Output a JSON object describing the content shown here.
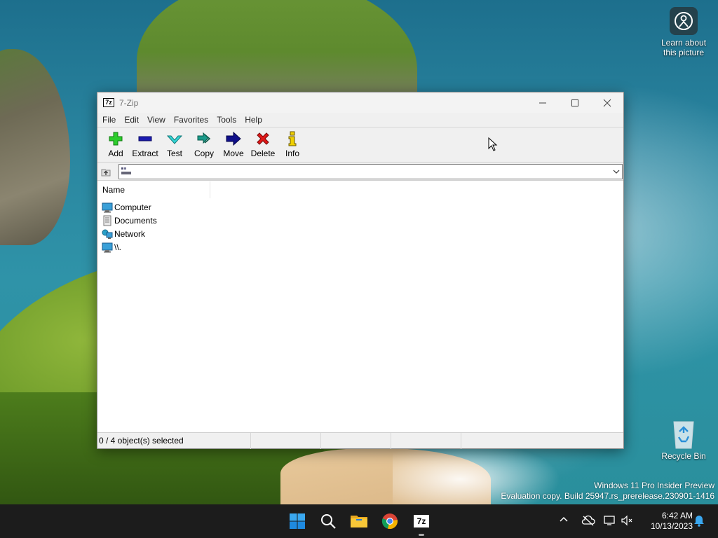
{
  "desktop": {
    "learn_icon_label": "Learn about this picture",
    "recycle_bin_label": "Recycle Bin",
    "watermark_line1": "Windows 11 Pro Insider Preview",
    "watermark_line2": "Evaluation copy. Build 25947.rs_prerelease.230901-1416"
  },
  "window": {
    "title": "7-Zip",
    "app_icon_text": "7z",
    "menu": [
      "File",
      "Edit",
      "View",
      "Favorites",
      "Tools",
      "Help"
    ],
    "toolbar": [
      {
        "label": "Add",
        "icon": "plus-icon",
        "color": "#22aa22"
      },
      {
        "label": "Extract",
        "icon": "minus-icon",
        "color": "#1a1aa0"
      },
      {
        "label": "Test",
        "icon": "check-icon",
        "color": "#1aa0a0"
      },
      {
        "label": "Copy",
        "icon": "double-arrow-icon",
        "color": "#1a7a6a"
      },
      {
        "label": "Move",
        "icon": "arrow-right-icon",
        "color": "#10107a"
      },
      {
        "label": "Delete",
        "icon": "x-icon",
        "color": "#d81a1a"
      },
      {
        "label": "Info",
        "icon": "info-icon",
        "color": "#e0c000"
      }
    ],
    "address": {
      "path_value": ""
    },
    "columns": {
      "name": "Name"
    },
    "items": [
      {
        "name": "Computer",
        "icon": "computer-icon"
      },
      {
        "name": "Documents",
        "icon": "document-icon"
      },
      {
        "name": "Network",
        "icon": "network-icon"
      },
      {
        "name": "\\\\.",
        "icon": "computer-icon"
      }
    ],
    "status": {
      "selection": "0 / 4 object(s) selected",
      "cell2": "",
      "cell3": "",
      "cell4": ""
    }
  },
  "taskbar": {
    "clock_time": "6:42 AM",
    "clock_date": "10/13/2023",
    "apps": [
      "start-icon",
      "search-icon",
      "file-explorer-icon",
      "chrome-icon",
      "7zip-icon"
    ],
    "zip_app_text": "7z"
  }
}
